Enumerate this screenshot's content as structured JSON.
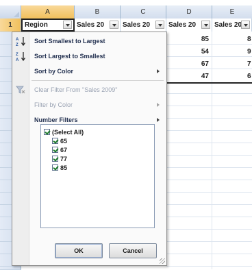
{
  "columns": [
    "A",
    "B",
    "C",
    "D",
    "E"
  ],
  "rows": [
    "1",
    "",
    "",
    "",
    "",
    "",
    "",
    "",
    "",
    "",
    "",
    "",
    "",
    "",
    "",
    "",
    "",
    "",
    "",
    "",
    ""
  ],
  "header_row": {
    "region": "Region",
    "sales_b": "Sales 20",
    "sales_c": "Sales 20",
    "sales_d": "Sales 20",
    "sales_e": "Sales 20"
  },
  "data_cols": {
    "d": [
      "85",
      "54",
      "67",
      "47"
    ],
    "e": [
      "8",
      "9",
      "7",
      "6"
    ]
  },
  "filter_menu": {
    "sort_asc": "Sort Smallest to Largest",
    "sort_desc": "Sort Largest to Smallest",
    "sort_color": "Sort by Color",
    "clear_filter": "Clear Filter From \"Sales 2009\"",
    "filter_color": "Filter by Color",
    "number_filters": "Number Filters",
    "values": [
      "(Select All)",
      "65",
      "67",
      "77",
      "85"
    ],
    "ok": "OK",
    "cancel": "Cancel"
  },
  "icons": {
    "sort_asc": "sort-ascending-icon",
    "sort_desc": "sort-descending-icon",
    "clear_filter": "funnel-clear-icon"
  }
}
